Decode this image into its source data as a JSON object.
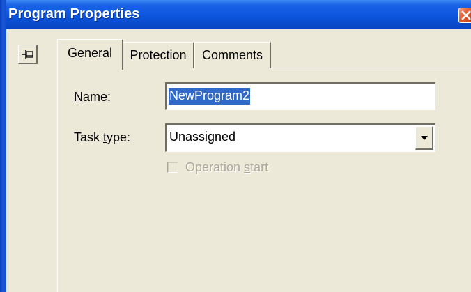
{
  "window": {
    "title": "Program Properties"
  },
  "tabs": [
    {
      "label": "General",
      "active": true
    },
    {
      "label": "Protection",
      "active": false
    },
    {
      "label": "Comments",
      "active": false
    }
  ],
  "form": {
    "name_label_mnemonic": "N",
    "name_label_rest": "ame:",
    "name_value": "NewProgram2",
    "task_label_pre": "Task ",
    "task_label_mnemonic": "t",
    "task_label_rest": "ype:",
    "task_value": "Unassigned",
    "operation_start_pre": "Operation ",
    "operation_start_mnemonic": "s",
    "operation_start_rest": "tart",
    "operation_start_checked": false
  },
  "icons": {
    "pin": "pin-icon",
    "close": "close-icon",
    "dropdown": "chevron-down-icon"
  },
  "colors": {
    "titlebar": "#0a4bcc",
    "selection": "#3169c6",
    "dialog_bg": "#ece9d8",
    "disabled_text": "#aca899"
  }
}
